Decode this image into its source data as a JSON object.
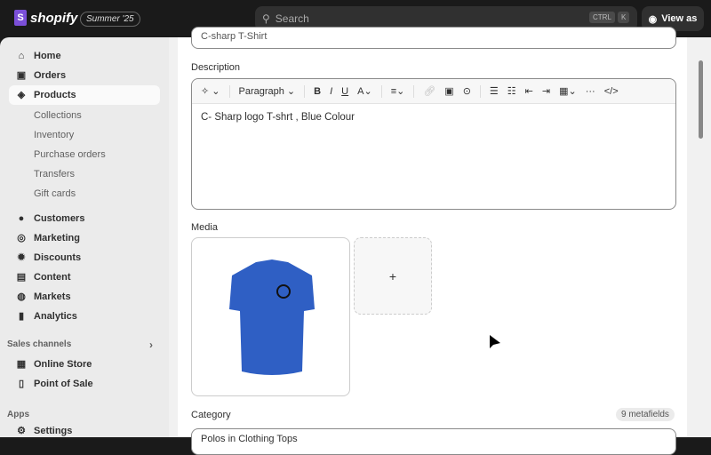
{
  "topbar": {
    "brand": "shopify",
    "edition": "Summer '25",
    "search_placeholder": "Search",
    "kbd_ctrl": "CTRL",
    "kbd_k": "K",
    "view_as": "View as"
  },
  "sidebar": {
    "items": [
      {
        "label": "Home",
        "icon": "⌂"
      },
      {
        "label": "Orders",
        "icon": "▣"
      },
      {
        "label": "Products",
        "icon": "◈"
      }
    ],
    "sub_items": [
      "Collections",
      "Inventory",
      "Purchase orders",
      "Transfers",
      "Gift cards"
    ],
    "items2": [
      {
        "label": "Customers",
        "icon": "●"
      },
      {
        "label": "Marketing",
        "icon": "◎"
      },
      {
        "label": "Discounts",
        "icon": "✹"
      },
      {
        "label": "Content",
        "icon": "▤"
      },
      {
        "label": "Markets",
        "icon": "◍"
      },
      {
        "label": "Analytics",
        "icon": "▮"
      }
    ],
    "sales_channels": "Sales channels",
    "channels": [
      "Online Store",
      "Point of Sale"
    ],
    "apps": "Apps",
    "settings": "Settings"
  },
  "product": {
    "title_value": "C-sharp T-Shirt",
    "description_label": "Description",
    "paragraph": "Paragraph",
    "description_text": "C- Sharp logo T-shrt , Blue Colour",
    "media_label": "Media",
    "add_media": "+",
    "category_label": "Category",
    "metafields": "9 metafields",
    "category_value": "Polos in Clothing Tops"
  }
}
